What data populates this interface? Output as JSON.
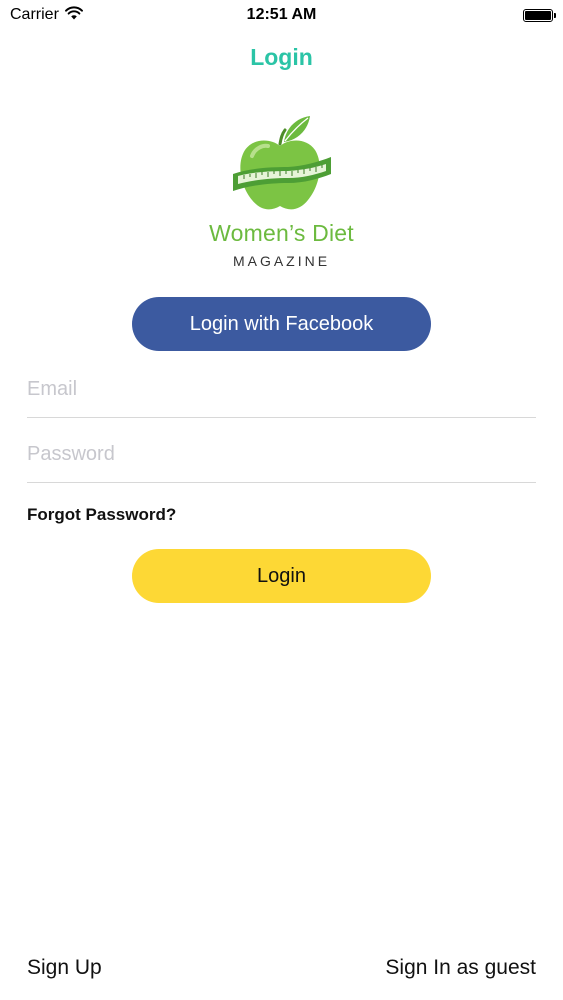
{
  "status_bar": {
    "carrier": "Carrier",
    "time": "12:51 AM"
  },
  "nav": {
    "title": "Login"
  },
  "logo": {
    "title": "Women’s Diet",
    "subtitle": "MAGAZINE"
  },
  "buttons": {
    "facebook_label": "Login with Facebook",
    "login_label": "Login"
  },
  "form": {
    "email_placeholder": "Email",
    "email_value": "",
    "password_placeholder": "Password",
    "password_value": "",
    "forgot_label": "Forgot Password?"
  },
  "footer": {
    "signup_label": "Sign Up",
    "guest_label": "Sign In as guest"
  },
  "colors": {
    "accent": "#2bc4a6",
    "facebook": "#3c5aa0",
    "login": "#fdd835",
    "logo_green": "#6cba3f"
  },
  "icons": [
    "wifi-icon",
    "battery-icon",
    "apple-tape-logo-icon"
  ]
}
